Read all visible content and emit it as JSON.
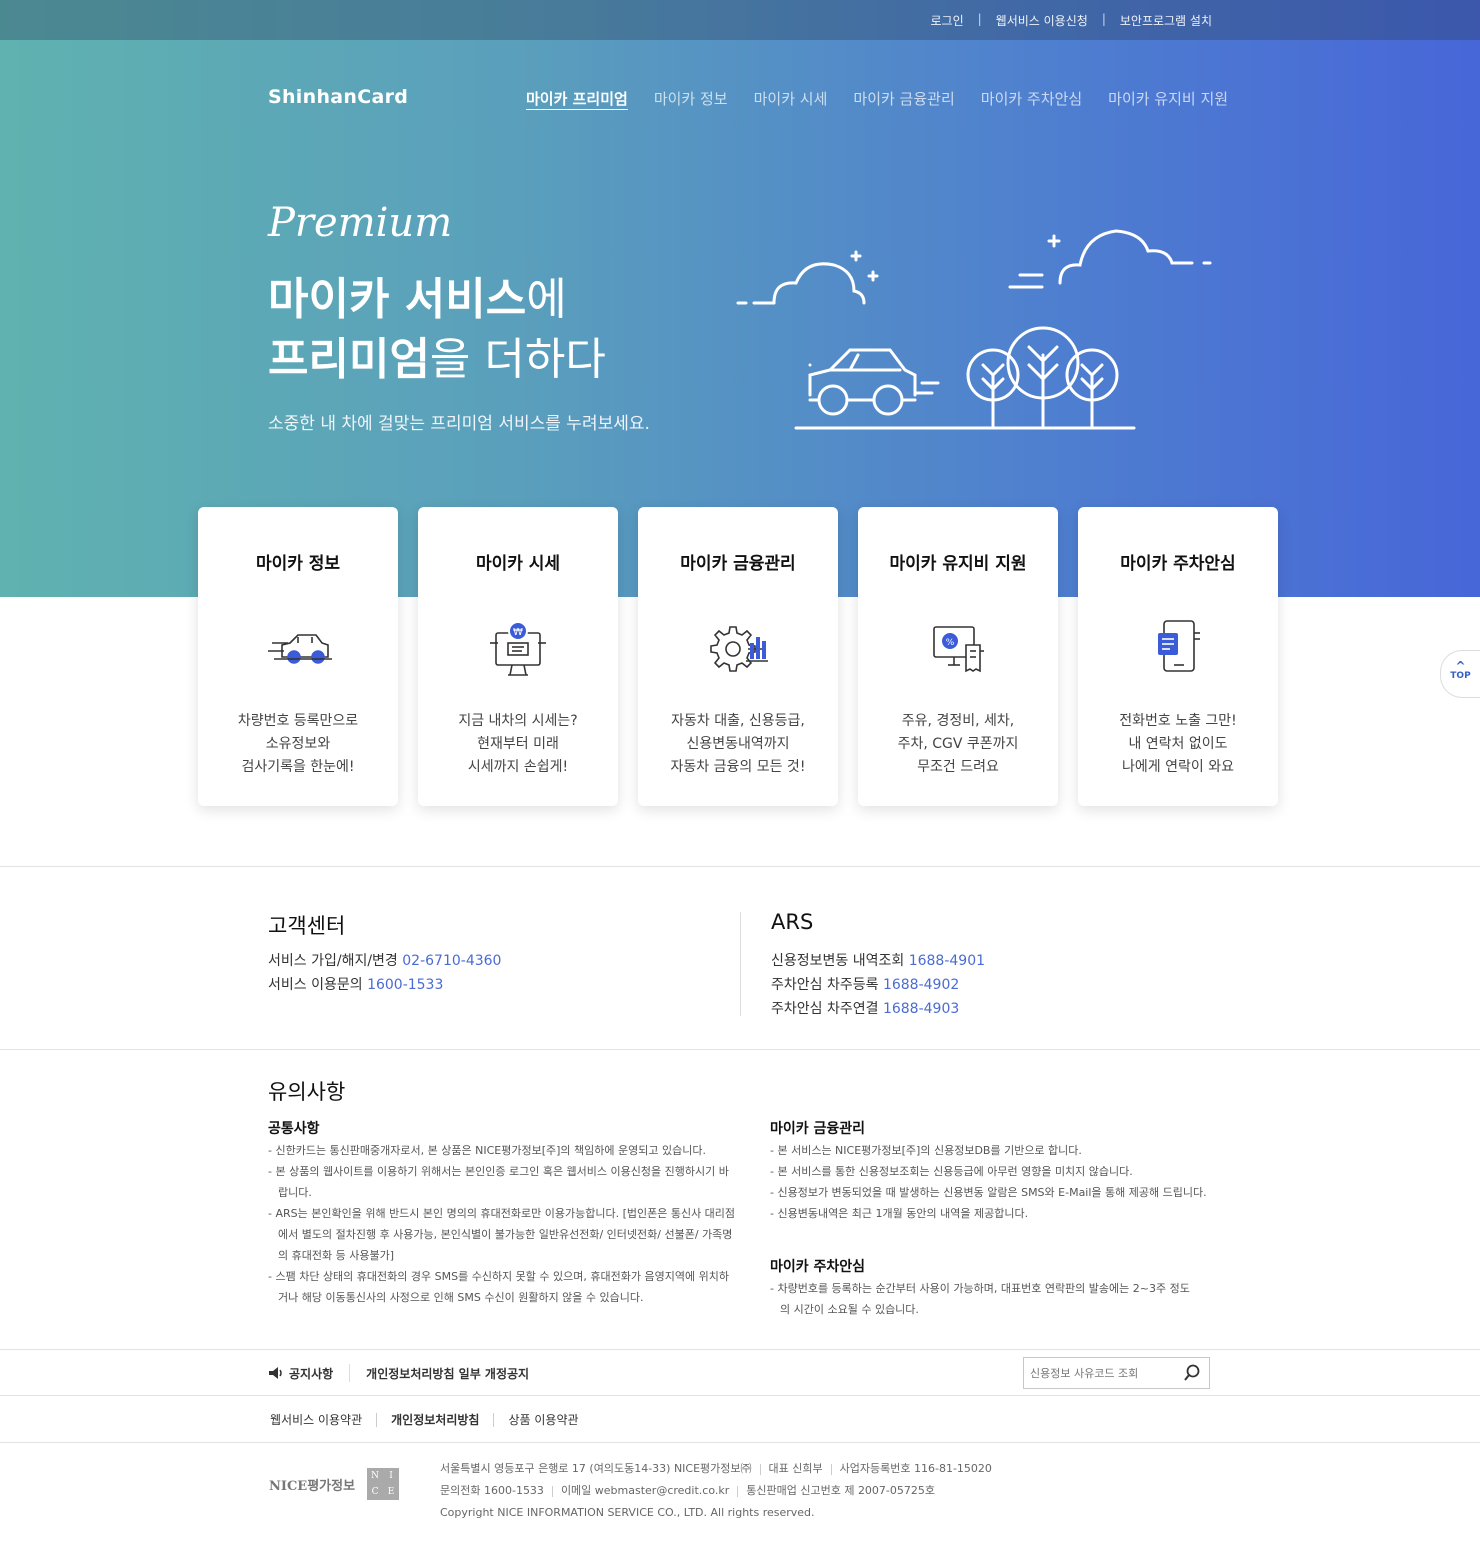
{
  "util_menu": [
    "로그인",
    "웹서비스 이용신청",
    "보안프로그램 설치"
  ],
  "logo": "ShinhanCard",
  "nav": [
    "마이카 프리미엄",
    "마이카 정보",
    "마이카 시세",
    "마이카 금융관리",
    "마이카 주차안심",
    "마이카 유지비 지원"
  ],
  "hero": {
    "premium": "Premium",
    "line1_bold": "마이카 서비스",
    "line1_light": "에",
    "line2_bold": "프리미엄",
    "line2_light": "을 더하다",
    "sub": "소중한 내 차에 걸맞는 프리미엄 서비스를 누려보세요."
  },
  "cards": [
    {
      "title": "마이카 정보",
      "icon": "car-icon",
      "desc": [
        "차량번호 등록만으로",
        "소유정보와",
        "검사기록을 한눈에!"
      ]
    },
    {
      "title": "마이카 시세",
      "icon": "monitor-price-icon",
      "desc": [
        "지금 내차의 시세는?",
        "현재부터 미래",
        "시세까지 손쉽게!"
      ]
    },
    {
      "title": "마이카 금융관리",
      "icon": "gear-chart-icon",
      "desc": [
        "자동차 대출, 신용등급,",
        "신용변동내역까지",
        "자동차 금융의 모든 것!"
      ]
    },
    {
      "title": "마이카 유지비 지원",
      "icon": "coupon-icon",
      "desc": [
        "주유, 경정비, 세차,",
        "주차, CGV 쿠폰까지",
        "무조건 드려요"
      ]
    },
    {
      "title": "마이카 주차안심",
      "icon": "phone-icon",
      "desc": [
        "전화번호 노출 그만!",
        "내 연락처 없이도",
        "나에게 연락이 와요"
      ]
    }
  ],
  "top_button": "TOP",
  "customer_center": {
    "title": "고객센터",
    "lines": [
      {
        "label": "서비스 가입/해지/변경 ",
        "number": "02-6710-4360"
      },
      {
        "label": "서비스 이용문의 ",
        "number": "1600-1533"
      }
    ]
  },
  "ars": {
    "title": "ARS",
    "lines": [
      {
        "label": "신용정보변동 내역조회 ",
        "number": "1688-4901"
      },
      {
        "label": "주차안심 차주등록 ",
        "number": "1688-4902"
      },
      {
        "label": "주차안심 차주연결 ",
        "number": "1688-4903"
      }
    ]
  },
  "notice": {
    "title": "유의사항",
    "common_title": "공통사항",
    "common": [
      "- 신한카드는 통신판매중개자로서, 본 상품은 NICE평가정보[주]의 책임하에 운영되고 있습니다.",
      "- 본 상품의 웹사이트를 이용하기 위해서는 본인인증 로그인 혹은 웹서비스 이용신청을 진행하시기 바랍니다.",
      "- ARS는 본인확인을 위해 반드시 본인 명의의 휴대전화로만 이용가능합니다. [법인폰은 통신사 대리점에서 별도의 절차진행 후 사용가능, 본인식별이 불가능한 일반유선전화/ 인터넷전화/ 선불폰/ 가족명의 휴대전화 등 사용불가]",
      "- 스팸 차단 상태의 휴대전화의 경우 SMS를 수신하지 못할 수 있으며, 휴대전화가 음영지역에 위치하거나 해당 이동통신사의 사정으로 인해 SMS 수신이 원활하지 않을 수 있습니다."
    ],
    "finance_title": "마이카 금융관리",
    "finance": [
      "- 본 서비스는 NICE평가정보[주]의 신용정보DB를 기반으로 합니다.",
      "- 본 서비스를 통한 신용정보조회는 신용등급에 아무런 영향을 미치지 않습니다.",
      "- 신용정보가 변동되었을 때 발생하는 신용변동 알람은 SMS와 E-Mail을 통해 제공해 드립니다.",
      "- 신용변동내역은 최근 1개월 동안의 내역을 제공합니다."
    ],
    "parking_title": "마이카 주차안심",
    "parking": [
      "- 차량번호를 등록하는 순간부터 사용이 가능하며, 대표번호 연락판의 발송에는 2~3주 정도의 시간이 소요될 수 있습니다."
    ]
  },
  "notice_bar": {
    "label": "공지사항",
    "item": "개인정보처리방침 일부 개정공지",
    "search_placeholder": "신용정보 사유코드 조회"
  },
  "footer_links": [
    "웹서비스 이용약관",
    "개인정보처리방침",
    "상품 이용약관"
  ],
  "footer": {
    "logo_text": "NICE평가정보",
    "logo_box": [
      "N",
      "I",
      "C",
      "E"
    ],
    "address": "서울특별시 영등포구 은행로 17 (여의도동14-33) NICE평가정보㈜",
    "ceo": "대표 신희부",
    "biz_no": "사업자등록번호 116-81-15020",
    "tel": "문의전화 1600-1533",
    "email": "이메일 webmaster@credit.co.kr",
    "report_no": "통신판매업 신고번호 제 2007-05725호",
    "copyright": "Copyright NICE INFORMATION SERVICE CO., LTD. All rights reserved."
  }
}
